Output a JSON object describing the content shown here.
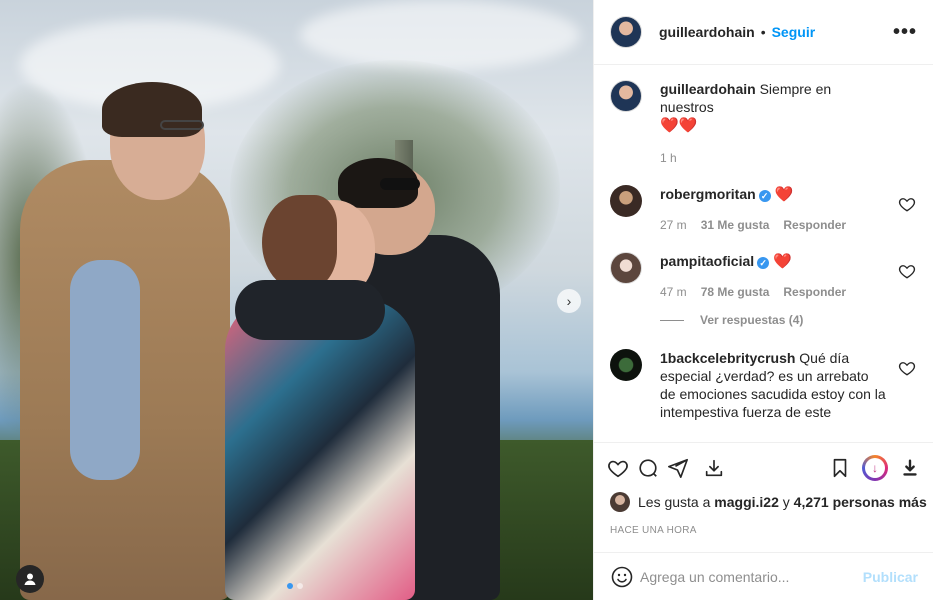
{
  "post": {
    "author": "guilleardohain",
    "follow_label": "Seguir",
    "separator": "•",
    "more_icon": "more-horizontal-icon",
    "photo_description_icon": "user-tag-icon",
    "carousel": {
      "current": 1,
      "total": 2
    }
  },
  "caption": {
    "username": "guilleardohain",
    "text": "Siempre en nuestros",
    "emoji": "❤️❤️",
    "time": "1 h"
  },
  "comments": [
    {
      "username": "robergmoritan",
      "verified": true,
      "text": "❤️",
      "time": "27 m",
      "likes": "31 Me gusta",
      "reply_label": "Responder"
    },
    {
      "username": "pampitaoficial",
      "verified": true,
      "text": "❤️",
      "time": "47 m",
      "likes": "78 Me gusta",
      "reply_label": "Responder",
      "view_replies": "Ver respuestas (4)"
    },
    {
      "username": "1backcelebritycrush",
      "verified": false,
      "text": "Qué día especial ¿verdad? es un arrebato de emociones sacudida estoy con la intempestiva fuerza de este"
    }
  ],
  "likes": {
    "prefix": "Les gusta a",
    "user": "maggi.i22",
    "joiner": "y",
    "others": "4,271 personas más"
  },
  "timestamp": "HACE UNA HORA",
  "add_comment": {
    "placeholder": "Agrega un comentario...",
    "publish_label": "Publicar"
  },
  "colors": {
    "accent": "#0095f6",
    "heart": "#e0245e",
    "publish_disabled": "#b2dffc",
    "muted": "#8e8e8e"
  }
}
